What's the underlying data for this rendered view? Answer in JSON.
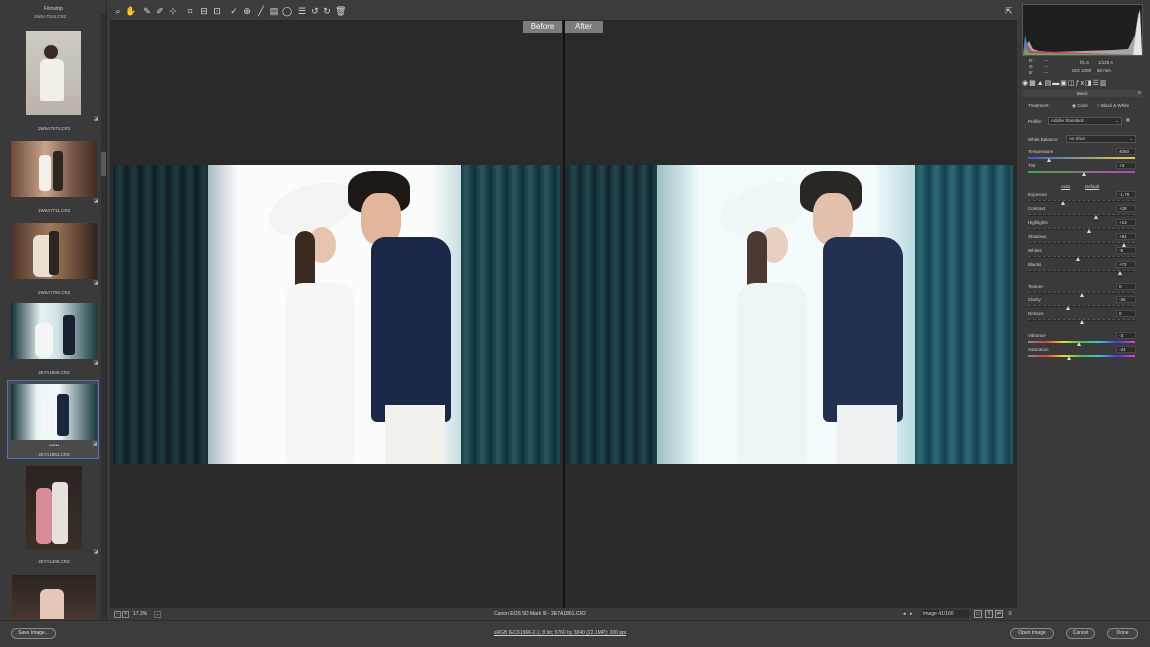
{
  "filmstrip": {
    "title": "Filmstrip",
    "items": [
      {
        "top_filename": "1W6A7516.CR2",
        "filename": "1W6A7573.CR2"
      },
      {
        "filename": "1W6A7711.CR2"
      },
      {
        "filename": "1W6A7760.CR2"
      },
      {
        "filename": "2E7A1849.CR2"
      },
      {
        "filename": "2E7A1861.CR2",
        "rating": "• • • • •"
      },
      {
        "filename": "2E7A1406.CR2"
      },
      {
        "filename": ""
      }
    ]
  },
  "toolbar": {
    "icons": [
      "zoom-icon",
      "hand-icon",
      "white-balance-icon",
      "color-sampler-icon",
      "targeted-adjust-icon",
      "crop-icon",
      "straighten-icon",
      "transform-icon",
      "spot-removal-icon",
      "red-eye-icon",
      "adjustment-brush-icon",
      "graduated-filter-icon",
      "radial-filter-icon",
      "presets-icon",
      "rotate-ccw-icon",
      "rotate-cw-icon",
      "trash-icon"
    ],
    "fullscreen_icon": "fullscreen-icon"
  },
  "preview": {
    "before_label": "Before",
    "after_label": "After"
  },
  "statusbar": {
    "zoom": "17.3%",
    "camera": "Canon EOS 5D Mark III",
    "separator": "-",
    "file": "2E7A1861.CR2",
    "image_counter": "Image 41/160"
  },
  "histogram": {
    "r_label": "R:",
    "g_label": "G:",
    "b_label": "B:",
    "r_value": "---",
    "g_value": "---",
    "b_value": "---",
    "aperture": "f/1.6",
    "shutter": "1/125 s",
    "iso": "ISO 1000",
    "focal": "50 mm"
  },
  "basic": {
    "section_title": "Basic",
    "treatment_label": "Treatment:",
    "treatment_color": "Color",
    "treatment_bw": "Black & White",
    "profile_label": "Profile:",
    "profile_value": "Adobe Standard",
    "wb_label": "White Balance:",
    "wb_value": "As Shot",
    "auto_label": "Auto",
    "default_label": "Default",
    "sliders": [
      {
        "label": "Temperature",
        "value": "4050",
        "pos": 0.2
      },
      {
        "label": "Tint",
        "value": "+3",
        "pos": 0.52
      },
      {
        "label": "Exposure",
        "value": "-1.70",
        "pos": 0.33
      },
      {
        "label": "Contrast",
        "value": "+28",
        "pos": 0.64
      },
      {
        "label": "Highlights",
        "value": "+13",
        "pos": 0.57
      },
      {
        "label": "Shadows",
        "value": "+81",
        "pos": 0.9
      },
      {
        "label": "Whites",
        "value": "-6",
        "pos": 0.47
      },
      {
        "label": "Blacks",
        "value": "+72",
        "pos": 0.86
      },
      {
        "label": "Texture",
        "value": "0",
        "pos": 0.5
      },
      {
        "label": "Clarity",
        "value": "-26",
        "pos": 0.37
      },
      {
        "label": "Dehaze",
        "value": "0",
        "pos": 0.5
      },
      {
        "label": "Vibrance",
        "value": "-3",
        "pos": 0.48
      },
      {
        "label": "Saturation",
        "value": "-24",
        "pos": 0.38
      }
    ]
  },
  "bottom": {
    "save_label": "Save Image...",
    "info_link": "sRGB IEC61966-2.1; 8 bit; 5760 by 3840 (22.1MP); 300 ppi",
    "open_label": "Open Image",
    "cancel_label": "Cancel",
    "done_label": "Done"
  }
}
